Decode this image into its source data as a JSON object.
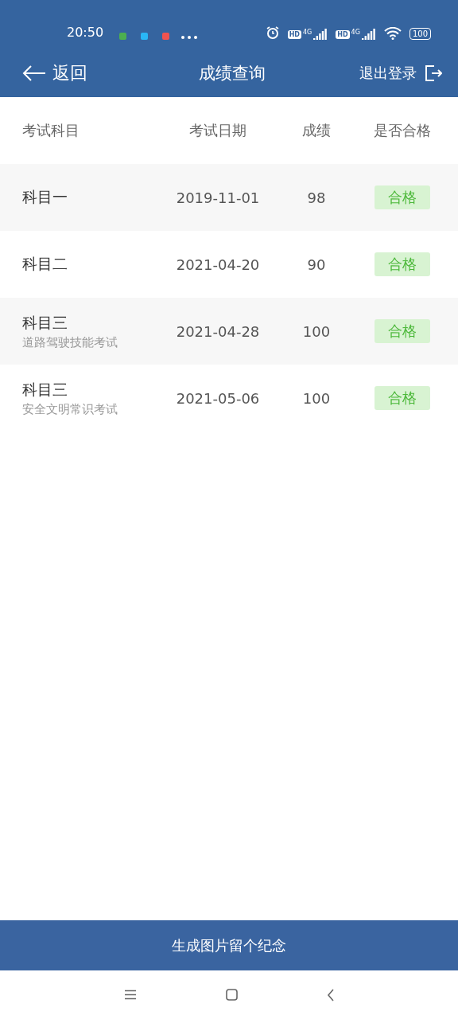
{
  "status_bar": {
    "time": "20:50",
    "app_notifications": [
      {
        "color": "#4caf50"
      },
      {
        "color": "#29b6f6"
      },
      {
        "color": "#ef5350"
      }
    ],
    "sims": [
      {
        "hd": "HD",
        "network": "4G"
      },
      {
        "hd": "HD",
        "network": "4G"
      }
    ],
    "battery": "100"
  },
  "header": {
    "back": "返回",
    "title": "成绩查询",
    "logout": "退出登录"
  },
  "table": {
    "columns": [
      "考试科目",
      "考试日期",
      "成绩",
      "是否合格"
    ],
    "rows": [
      {
        "subject": "科目一",
        "date": "2019-11-01",
        "score": "98",
        "result": {
          "label": "合格",
          "passed": true
        }
      },
      {
        "subject": "科目二",
        "date": "2021-04-20",
        "score": "90",
        "result": {
          "label": "合格",
          "passed": true
        }
      },
      {
        "subject": "科目三",
        "note": "道路驾驶技能考试",
        "date": "2021-04-28",
        "score": "100",
        "result": {
          "label": "合格",
          "passed": true
        }
      },
      {
        "subject": "科目三",
        "note": "安全文明常识考试",
        "date": "2021-05-06",
        "score": "100",
        "result": {
          "label": "合格",
          "passed": true
        }
      }
    ]
  },
  "action_button": "生成图片留个纪念"
}
